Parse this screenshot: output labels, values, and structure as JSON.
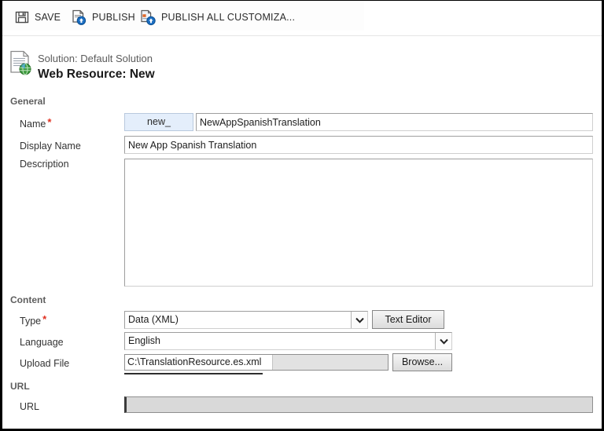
{
  "window": {
    "border_color": "#000000",
    "background": "#ffffff"
  },
  "command_bar": {
    "buttons": [
      {
        "id": "save",
        "label": "SAVE",
        "icon": "save-icon"
      },
      {
        "id": "publish",
        "label": "PUBLISH",
        "icon": "publish-icon"
      },
      {
        "id": "publish-all",
        "label": "PUBLISH ALL CUSTOMIZA...",
        "icon": "publish-all-icon"
      }
    ]
  },
  "record_header": {
    "icon": "web-resource-icon",
    "solution_line": "Solution: Default Solution",
    "title": "Web Resource: New"
  },
  "sections": {
    "general": {
      "label": "General",
      "fields": {
        "name": {
          "label": "Name",
          "required": true,
          "prefix": "new_",
          "value": "NewAppSpanishTranslation"
        },
        "display_name": {
          "label": "Display Name",
          "required": false,
          "value": "New App Spanish Translation"
        },
        "description": {
          "label": "Description",
          "required": false,
          "value": ""
        }
      }
    },
    "content": {
      "label": "Content",
      "fields": {
        "type": {
          "label": "Type",
          "required": true,
          "value": "Data (XML)",
          "icon": "chevron-down-icon"
        },
        "text_editor_button": {
          "label": "Text Editor"
        },
        "language": {
          "label": "Language",
          "required": false,
          "value": "English",
          "icon": "chevron-down-icon"
        },
        "upload_file": {
          "label": "Upload File",
          "required": false,
          "value": "C:\\TranslationResource.es.xml",
          "browse_label": "Browse..."
        }
      }
    },
    "url": {
      "label": "URL",
      "fields": {
        "url": {
          "label": "URL",
          "required": false,
          "value": "",
          "disabled": true
        }
      }
    }
  },
  "colors": {
    "required_asterisk": "#e03020",
    "section_label": "#5e5e5e",
    "prefix_background": "#e4eefb",
    "disabled_field": "#d9d9d9",
    "publish_badge": "#1b6ec2"
  }
}
